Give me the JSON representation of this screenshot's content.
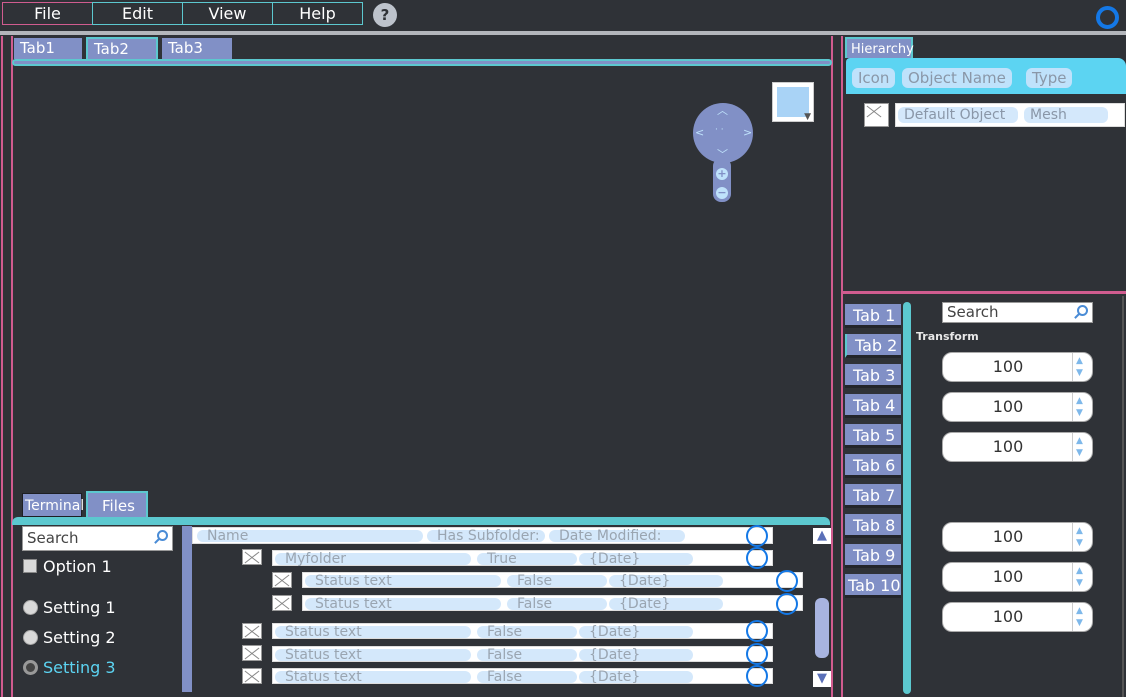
{
  "menu": {
    "file": "File",
    "edit": "Edit",
    "view": "View",
    "help": "Help",
    "help_icon": "?"
  },
  "viewport_tabs": [
    "Tab1",
    "Tab2",
    "Tab3"
  ],
  "bottom_tabs": {
    "terminal": "Terminal",
    "files": "Files"
  },
  "files_panel": {
    "search_placeholder": "Search",
    "option1": "Option 1",
    "settings": [
      "Setting 1",
      "Setting 2",
      "Setting 3"
    ],
    "columns": {
      "name": "Name",
      "has_subfolder": "Has Subfolder:",
      "date_modified": "Date Modified:"
    },
    "rows": [
      {
        "name": "Myfolder",
        "sub": "True",
        "date": "{Date}"
      },
      {
        "name": "Status text",
        "sub": "False",
        "date": "{Date}"
      },
      {
        "name": "Status text",
        "sub": "False",
        "date": "{Date}"
      },
      {
        "name": "Status text",
        "sub": "False",
        "date": "{Date}"
      },
      {
        "name": "Status text",
        "sub": "False",
        "date": "{Date}"
      },
      {
        "name": "Status text",
        "sub": "False",
        "date": "{Date}"
      }
    ],
    "scroll_up": "▲",
    "scroll_down": "▼"
  },
  "hierarchy": {
    "tab": "Hierarchy",
    "columns": {
      "icon": "Icon",
      "object_name": "Object Name",
      "type": "Type"
    },
    "object": {
      "name": "Default Object",
      "type": "Mesh"
    }
  },
  "inspector": {
    "tabs": [
      "Tab 1",
      "Tab 2",
      "Tab 3",
      "Tab 4",
      "Tab 5",
      "Tab 6",
      "Tab 7",
      "Tab 8",
      "Tab 9",
      "Tab 10"
    ],
    "search_placeholder": "Search",
    "section": "Transform",
    "values": [
      "100",
      "100",
      "100",
      "100",
      "100",
      "100"
    ]
  },
  "colors": {
    "background": "#2f3237",
    "accent_teal": "#5cc8cf",
    "accent_pink": "#d05c8f",
    "tab_blue": "#8190c6",
    "ring_blue": "#1478e6"
  }
}
